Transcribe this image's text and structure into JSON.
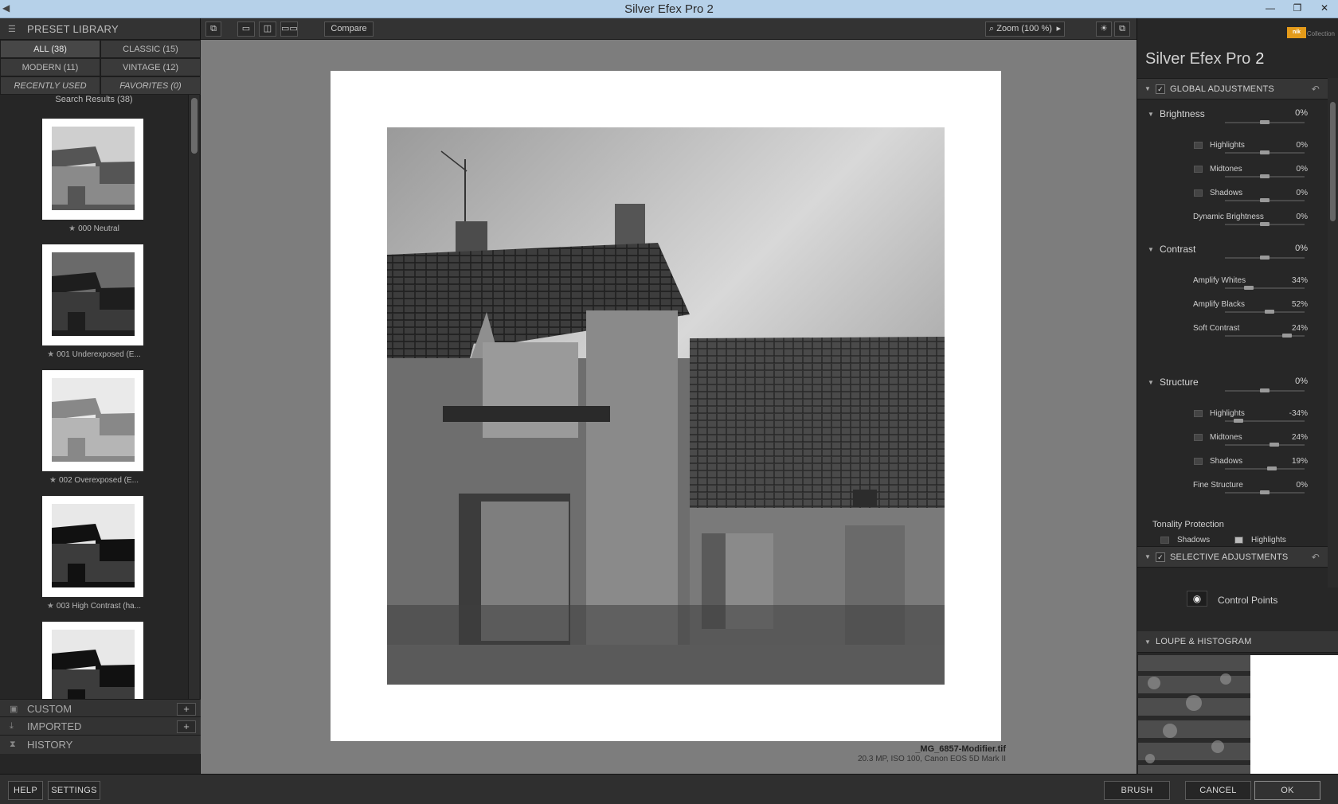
{
  "window": {
    "title": "Silver Efex Pro 2",
    "controls": [
      "—",
      "❐",
      "✕"
    ]
  },
  "left_panel": {
    "header": "PRESET LIBRARY",
    "tabs": [
      {
        "label": "ALL (38)",
        "active": true
      },
      {
        "label": "CLASSIC (15)"
      },
      {
        "label": "MODERN (11)"
      },
      {
        "label": "VINTAGE (12)"
      },
      {
        "label": "RECENTLY USED"
      },
      {
        "label": "FAVORITES (0)"
      }
    ],
    "search_results": "Search Results (38)",
    "presets": [
      {
        "label": "000 Neutral",
        "tone": "neutral"
      },
      {
        "label": "001 Underexposed (E...",
        "tone": "dark"
      },
      {
        "label": "002 Overexposed (E...",
        "tone": "light"
      },
      {
        "label": "003 High Contrast (ha...",
        "tone": "contrast"
      },
      {
        "label": "",
        "tone": "contrast"
      }
    ],
    "collections": [
      {
        "label": "CUSTOM",
        "has_add": true,
        "add_label": "+"
      },
      {
        "label": "IMPORTED",
        "has_add": true,
        "add_label": "+"
      },
      {
        "label": "HISTORY",
        "has_add": false
      }
    ]
  },
  "toolbar": {
    "compare_label": "Compare",
    "zoom_label": "Zoom (100 %)",
    "zoom_arrow": "▸"
  },
  "preview": {
    "file_name": "_MG_6857-Modifier.tif",
    "file_meta": "20.3 MP, ISO 100, Canon EOS 5D Mark II"
  },
  "right_panel": {
    "brand_badge": "nik",
    "brand_collection": "Collection",
    "product_name": "Silver Efex Pro",
    "product_version": "2",
    "global_header": "GLOBAL ADJUSTMENTS",
    "groups": [
      {
        "name": "Brightness",
        "value": "0%",
        "knob": 0.5,
        "subs": [
          {
            "name": "Highlights",
            "value": "0%",
            "knob": 0.5,
            "box": true
          },
          {
            "name": "Midtones",
            "value": "0%",
            "knob": 0.5,
            "box": true
          },
          {
            "name": "Shadows",
            "value": "0%",
            "knob": 0.5,
            "box": true
          },
          {
            "name": "Dynamic Brightness",
            "value": "0%",
            "knob": 0.5,
            "box": false
          }
        ]
      },
      {
        "name": "Contrast",
        "value": "0%",
        "knob": 0.5,
        "subs": [
          {
            "name": "Amplify Whites",
            "value": "34%",
            "knob": 0.3,
            "box": false
          },
          {
            "name": "Amplify Blacks",
            "value": "52%",
            "knob": 0.56,
            "box": false
          },
          {
            "name": "Soft Contrast",
            "value": "24%",
            "knob": 0.78,
            "box": false
          }
        ]
      },
      {
        "name": "Structure",
        "value": "0%",
        "knob": 0.5,
        "subs": [
          {
            "name": "Highlights",
            "value": "-34%",
            "knob": 0.17,
            "box": true
          },
          {
            "name": "Midtones",
            "value": "24%",
            "knob": 0.62,
            "box": true
          },
          {
            "name": "Shadows",
            "value": "19%",
            "knob": 0.59,
            "box": true
          },
          {
            "name": "Fine Structure",
            "value": "0%",
            "knob": 0.5,
            "box": false
          }
        ]
      }
    ],
    "tonality_title": "Tonality Protection",
    "tonality_items": [
      "Shadows",
      "Highlights"
    ],
    "selective_header": "SELECTIVE ADJUSTMENTS",
    "control_points_label": "Control Points",
    "loupe_header": "LOUPE & HISTOGRAM"
  },
  "bottom_bar": {
    "help": "HELP",
    "settings": "SETTINGS",
    "brush": "BRUSH",
    "cancel": "CANCEL",
    "ok": "OK"
  }
}
